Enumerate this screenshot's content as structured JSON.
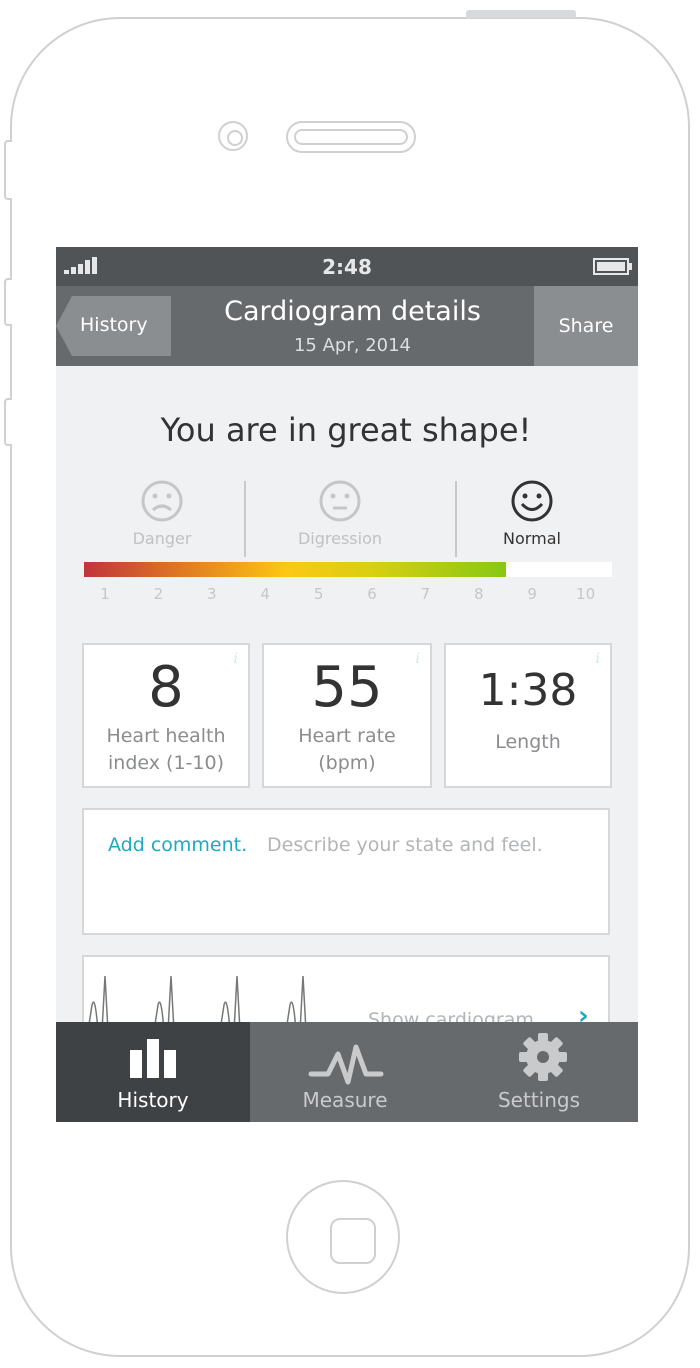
{
  "status": {
    "time": "2:48",
    "signal_icon": "signal-bars-icon",
    "battery_icon": "battery-icon"
  },
  "nav": {
    "back_label": "History",
    "title": "Cardiogram details",
    "date": "15 Apr, 2014",
    "share_label": "Share"
  },
  "headline": "You are in great shape!",
  "moods": [
    {
      "label": "Danger",
      "icon": "sad-face-icon",
      "active": false
    },
    {
      "label": "Digression",
      "icon": "neutral-face-icon",
      "active": false
    },
    {
      "label": "Normal",
      "icon": "smile-face-icon",
      "active": true
    }
  ],
  "scale": {
    "value": 8,
    "max": 10,
    "ticks": [
      "1",
      "2",
      "3",
      "4",
      "5",
      "6",
      "7",
      "8",
      "9",
      "10"
    ]
  },
  "metrics": [
    {
      "value": "8",
      "label1": "Heart health",
      "label2": "index (1-10)"
    },
    {
      "value": "55",
      "label1": "Heart rate",
      "label2": "(bpm)"
    },
    {
      "value": "1:38",
      "label1": "Length",
      "label2": ""
    }
  ],
  "info_glyph": "i",
  "comment": {
    "action": "Add comment.",
    "placeholder": "Describe your state and feel."
  },
  "cardiogram": {
    "link_label": "Show cardiogram"
  },
  "tabs": [
    {
      "label": "History",
      "icon": "bar-chart-icon",
      "active": true
    },
    {
      "label": "Measure",
      "icon": "pulse-icon",
      "active": false
    },
    {
      "label": "Settings",
      "icon": "gear-icon",
      "active": false
    }
  ],
  "colors": {
    "accent": "#1fa9c0",
    "nav": "#676a6c",
    "status": "#505457",
    "active_tab": "#3f4244"
  }
}
